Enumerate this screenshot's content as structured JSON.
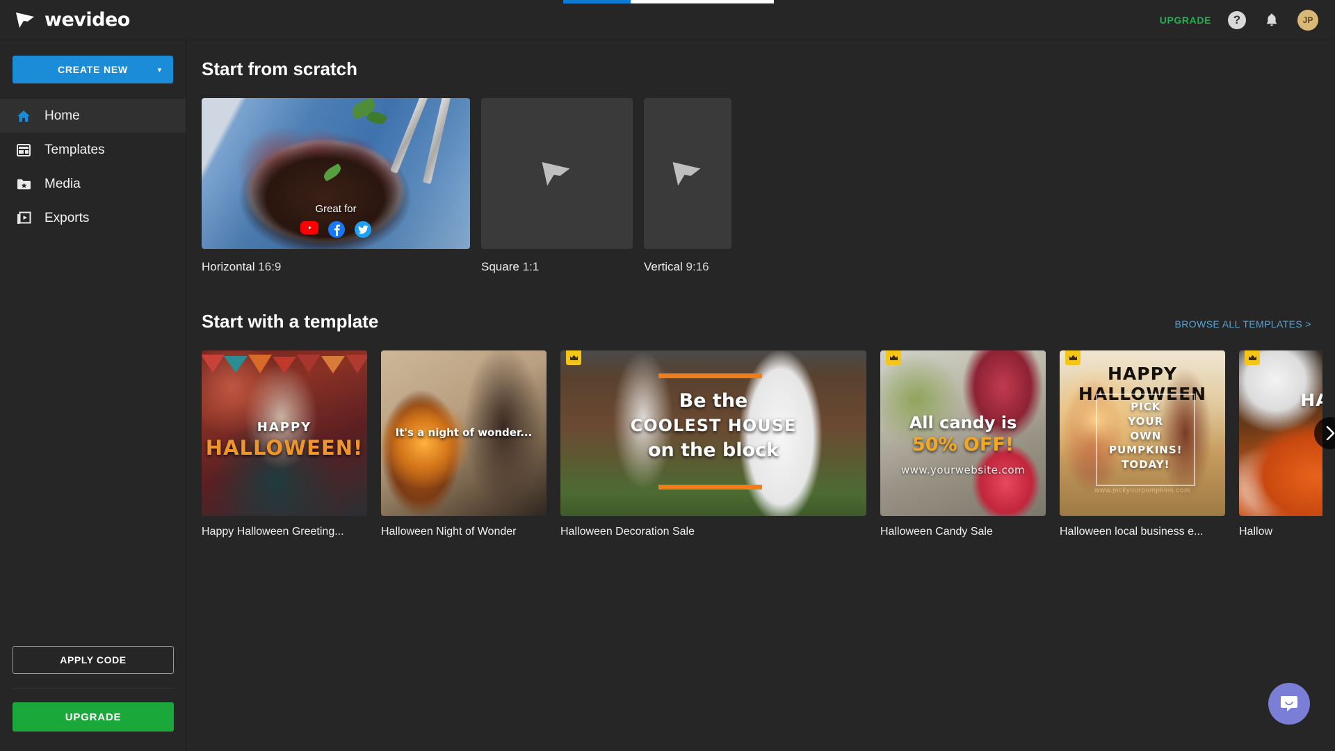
{
  "header": {
    "logo_text": "wevideo",
    "logo_icon": "wevideo-play-mark-icon",
    "upgrade_label": "UPGRADE",
    "help_label": "?",
    "help_icon": "question-circle-icon",
    "notifications_icon": "bell-icon",
    "avatar_initials": "JP"
  },
  "loading": {
    "progress_percent": 32,
    "fill_color": "#0c7cd5",
    "track_color": "#ffffff"
  },
  "sidebar": {
    "create_new_label": "CREATE NEW",
    "create_new_chevron": "chevron-down-icon",
    "create_new_color": "#1b8dd8",
    "items": [
      {
        "label": "Home",
        "icon": "home-icon",
        "active": true
      },
      {
        "label": "Templates",
        "icon": "templates-icon",
        "active": false
      },
      {
        "label": "Media",
        "icon": "media-folder-star-icon",
        "active": false
      },
      {
        "label": "Exports",
        "icon": "exports-play-icon",
        "active": false
      }
    ],
    "apply_code_label": "APPLY CODE",
    "upgrade_label": "UPGRADE",
    "upgrade_color": "#1aa83a"
  },
  "scratch": {
    "title": "Start from scratch",
    "great_for_label": "Great for",
    "social": [
      {
        "name": "youtube-icon",
        "color": "#ff0000"
      },
      {
        "name": "facebook-icon",
        "color": "#1877f2"
      },
      {
        "name": "twitter-icon",
        "color": "#1da1f2"
      }
    ],
    "cards": [
      {
        "name": "Horizontal",
        "ratio": "16:9"
      },
      {
        "name": "Square",
        "ratio": "1:1"
      },
      {
        "name": "Vertical",
        "ratio": "9:16"
      }
    ]
  },
  "templates": {
    "title": "Start with a template",
    "browse_all_label": "BROWSE ALL TEMPLATES >",
    "browse_all_color": "#58a6d8",
    "next_arrow_icon": "chevron-right-icon",
    "premium_badge_icon": "crown-icon",
    "items": [
      {
        "label": "Happy Halloween Greeting...",
        "premium": false,
        "overlay": {
          "line1": "HAPPY",
          "line2": "HALLOWEEN!"
        }
      },
      {
        "label": "Halloween Night of Wonder",
        "premium": false,
        "overlay": {
          "caption": "It's a night of wonder..."
        }
      },
      {
        "label": "Halloween Decoration Sale",
        "premium": true,
        "overlay": {
          "line1": "Be the",
          "line2": "COOLEST HOUSE",
          "line3": "on the block"
        }
      },
      {
        "label": "Halloween Candy Sale",
        "premium": true,
        "overlay": {
          "line1": "All candy is",
          "line2": "50% OFF!",
          "line3": "www.yourwebsite.com"
        }
      },
      {
        "label": "Halloween local business e...",
        "premium": true,
        "overlay": {
          "banner": "HAPPY HALLOWEEN",
          "body": "PICK\nYOUR\nOWN\nPUMPKINS!\nTODAY!",
          "site": "www.pickyourpumpkins.com"
        }
      },
      {
        "label": "Hallow",
        "premium": true,
        "overlay": {
          "line1": "HAP"
        }
      }
    ]
  },
  "chat": {
    "icon": "intercom-chat-icon",
    "color": "#7a7ed4"
  }
}
